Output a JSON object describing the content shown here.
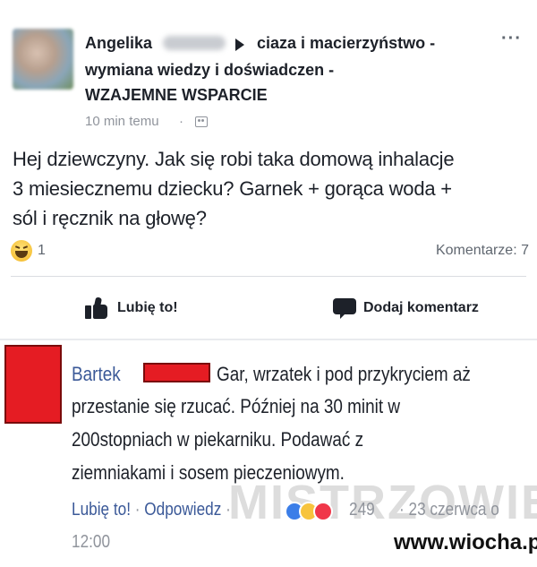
{
  "post": {
    "author_name": "Angelika",
    "group_name": "ciaza i macierzyństwo -",
    "group_name_line2": "wymiana wiedzy  i doświadczen -",
    "group_name_line3": "WZAJEMNE WSPARCIE",
    "more_icon": "more-horizontal-icon",
    "timestamp": "10 min temu",
    "meta_separator": "·",
    "audience_icon": "group-audience-icon",
    "text_lines": [
      "Hej dziewczyny. Jak się robi taka domową inhalacje",
      "3 miesiecznemu dziecku? Garnek + gorąca woda +",
      "sól i ręcznik na głowę?"
    ],
    "reaction_icon": "haha-reaction-icon",
    "reaction_count": "1",
    "comments_count": "Komentarze: 7",
    "like_label": "Lubię to!",
    "comment_label": "Dodaj komentarz"
  },
  "comment": {
    "author_name": "Bartek",
    "text_lines": [
      "Gar, wrzatek i pod przykryciem aż",
      "przestanie się rzucać. Później na 30 minit w",
      "200stopniach w piekarniku. Podawać z",
      "ziemniakami i sosem pieczeniowym."
    ],
    "like_action": "Lubię to!",
    "separator": " · ",
    "reply_action": "Odpowiedz",
    "action_separator_2": " · ",
    "reactions_count": "249",
    "date": "· 23 czerwca o",
    "time": "12:00"
  },
  "watermarks": {
    "mistrzowie": "MISTRZOWIE",
    "wiocha": "www.wiocha.pl"
  },
  "colors": {
    "link_blue": "#3b5998",
    "redaction_red": "#e51c23",
    "muted_gray": "#90949c"
  }
}
